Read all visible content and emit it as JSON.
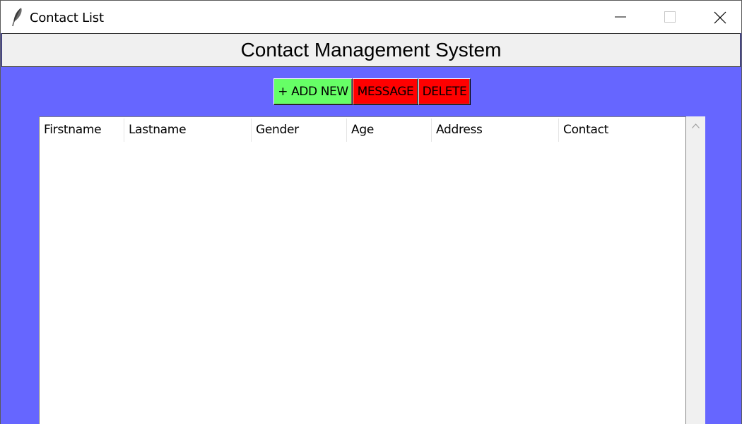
{
  "window": {
    "title": "Contact List",
    "controls": {
      "minimize_icon": "minimize-icon",
      "maximize_icon": "maximize-icon",
      "close_icon": "close-icon"
    }
  },
  "header": {
    "title": "Contact Management System"
  },
  "toolbar": {
    "add_label": "+ ADD NEW",
    "message_label": "MESSAGE",
    "delete_label": "DELETE"
  },
  "table": {
    "columns": [
      "Firstname",
      "Lastname",
      "Gender",
      "Age",
      "Address",
      "Contact"
    ],
    "rows": []
  },
  "colors": {
    "window_background": "#6666ff",
    "add_button": "#66ff66",
    "message_button": "#ff0000",
    "delete_button": "#ff0000",
    "header_bar": "#f0f0f0"
  }
}
